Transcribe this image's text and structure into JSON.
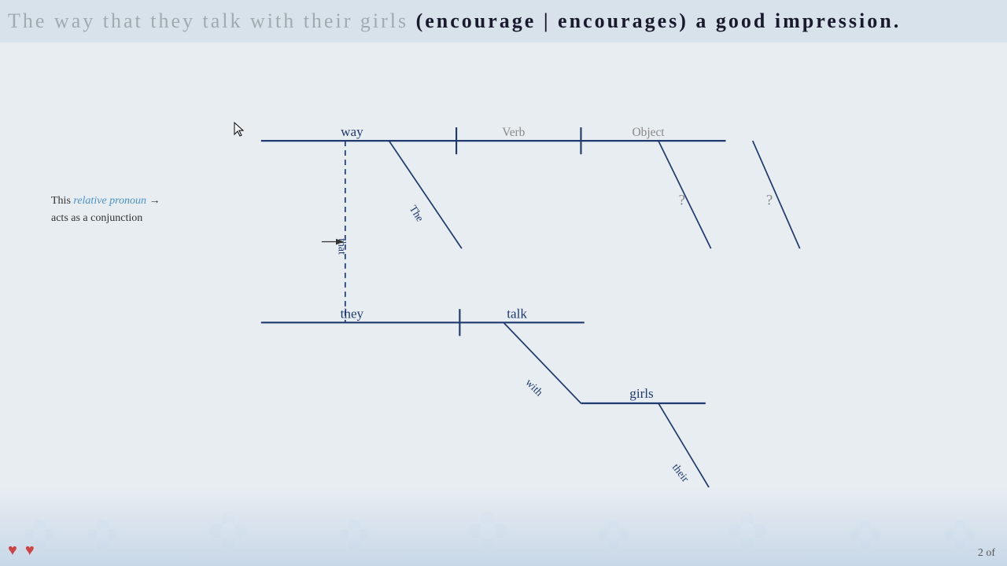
{
  "sentence": {
    "gray_part": "The  way  that  they  talk  with  their  girls",
    "black_part": "(encourage  |  encourages)  a  good  impression.",
    "full": "The way that they talk with their girls (encourage | encourages) a good impression."
  },
  "diagram": {
    "nodes": {
      "way": "way",
      "verb": "Verb",
      "object": "Object",
      "they": "they",
      "talk": "talk",
      "girls": "girls",
      "article_the": "The",
      "prep_with": "with",
      "det_their": "their"
    },
    "annotation": {
      "line1": "This ",
      "link_text": "relative pronoun",
      "line1_end": "",
      "line2": "acts as a conjunction",
      "pronoun": "that"
    }
  },
  "page": {
    "number": "2 of"
  },
  "colors": {
    "dark_blue": "#1e3a6e",
    "medium_blue": "#2e6db4",
    "light_blue": "#4a90c4",
    "gray_text": "#a0aab0",
    "dark_text": "#1a1a2e"
  }
}
